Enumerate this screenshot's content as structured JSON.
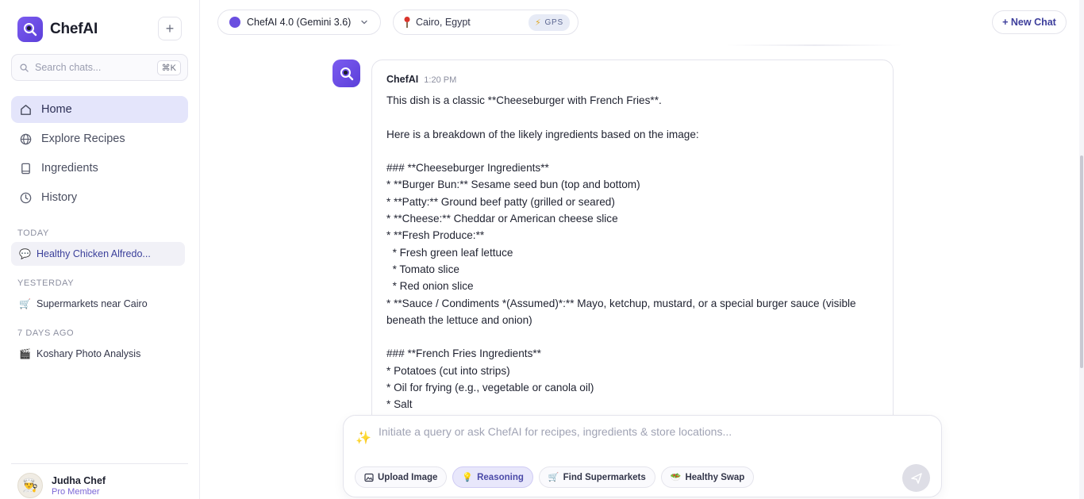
{
  "app": {
    "name": "ChefAI",
    "new_button": "+"
  },
  "sidebar": {
    "search": {
      "placeholder": "Search chats...",
      "shortcut": "⌘K"
    },
    "nav": [
      {
        "label": "Home",
        "icon": "home-icon",
        "active": true
      },
      {
        "label": "Explore Recipes",
        "icon": "globe-icon",
        "active": false
      },
      {
        "label": "Ingredients",
        "icon": "book-icon",
        "active": false
      },
      {
        "label": "History",
        "icon": "clock-icon",
        "active": false
      }
    ],
    "sections": [
      {
        "label": "TODAY",
        "chats": [
          {
            "title": "Healthy Chicken Alfredo...",
            "icon": "chat-bubble-icon",
            "active": true
          }
        ]
      },
      {
        "label": "YESTERDAY",
        "chats": [
          {
            "title": "Supermarkets near Cairo",
            "icon": "cart-icon",
            "active": false
          }
        ]
      },
      {
        "label": "7 DAYS AGO",
        "chats": [
          {
            "title": "Koshary Photo Analysis",
            "icon": "clapper-icon",
            "active": false
          }
        ]
      }
    ],
    "user": {
      "name": "Judha Chef",
      "role": "Pro Member"
    }
  },
  "topbar": {
    "model": "ChefAI 4.0 (Gemini 3.6)",
    "location": "Cairo, Egypt",
    "gps_label": "GPS",
    "new_chat": "+ New Chat"
  },
  "message": {
    "author": "ChefAI",
    "time": "1:20 PM",
    "lines": [
      "This dish is a classic **Cheeseburger with French Fries**.",
      "",
      "Here is a breakdown of the likely ingredients based on the image:",
      "",
      "### **Cheeseburger Ingredients**",
      "* **Burger Bun:** Sesame seed bun (top and bottom)",
      "* **Patty:** Ground beef patty (grilled or seared)",
      "* **Cheese:** Cheddar or American cheese slice",
      "* **Fresh Produce:**",
      "  * Fresh green leaf lettuce",
      "  * Tomato slice",
      "  * Red onion slice",
      "* **Sauce / Condiments *(Assumed)*:** Mayo, ketchup, mustard, or a special burger sauce (visible beneath the lettuce and onion)",
      "",
      "### **French Fries Ingredients**",
      "* Potatoes (cut into strips)",
      "* Oil for frying (e.g., vegetable or canola oil)",
      "* Salt"
    ]
  },
  "composer": {
    "placeholder": "Initiate a query or ask ChefAI for recipes, ingredients & store locations...",
    "chips": [
      {
        "label": "Upload Image",
        "icon": "image-icon",
        "active": false
      },
      {
        "label": "Reasoning",
        "icon": "lightbulb-icon",
        "active": true
      },
      {
        "label": "Find Supermarkets",
        "icon": "cart-icon",
        "active": false
      },
      {
        "label": "Healthy Swap",
        "icon": "salad-icon",
        "active": false
      }
    ]
  },
  "colors": {
    "accent": "#5b3fd9",
    "active_nav_bg": "#e4e5fb",
    "send_disabled": "#dedee6"
  }
}
